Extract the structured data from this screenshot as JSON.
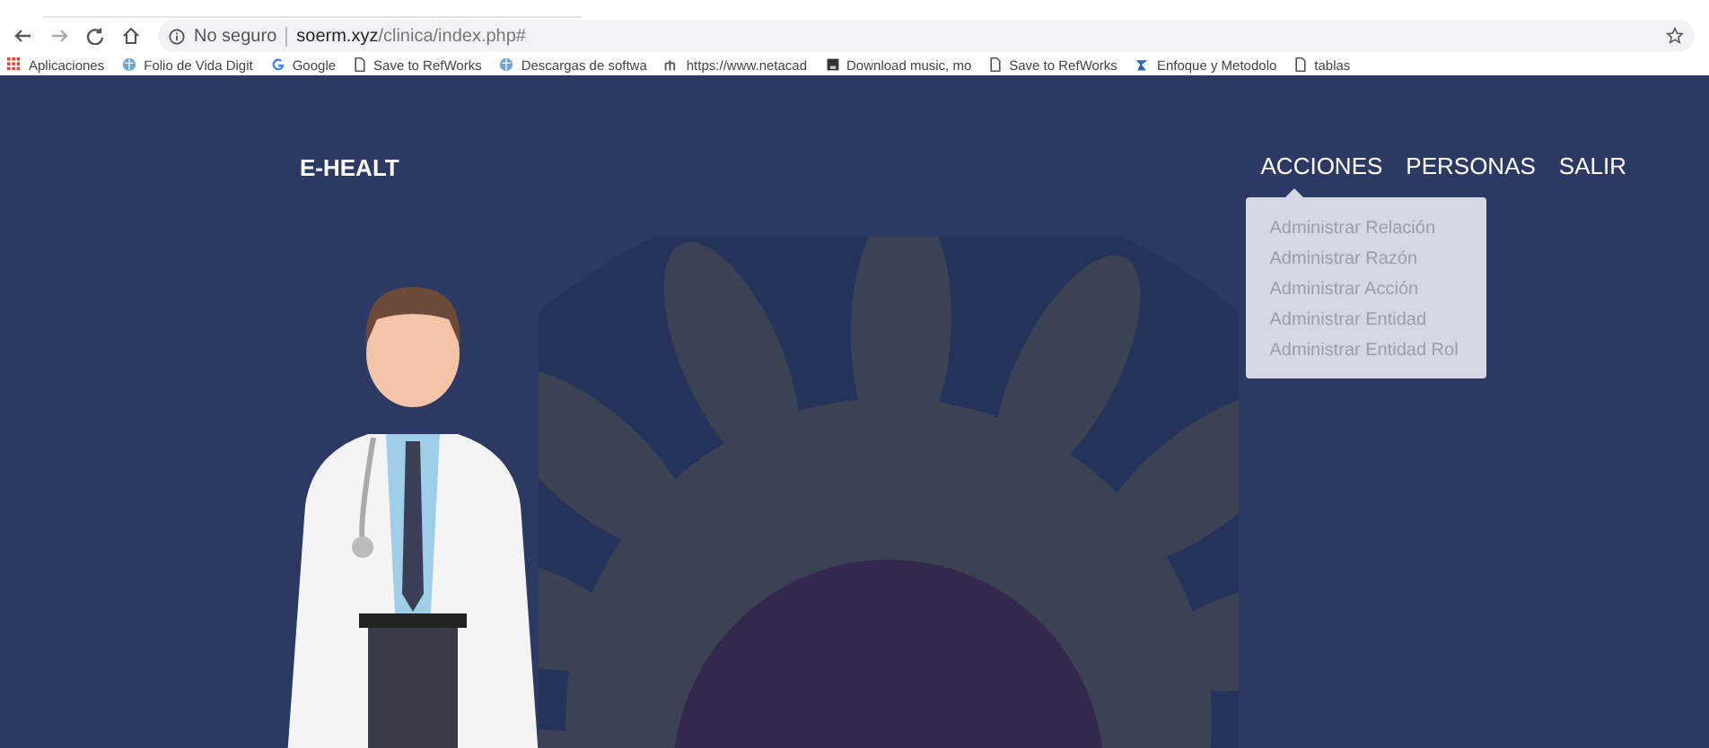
{
  "browser": {
    "security": "No seguro",
    "url": "**soerm.xyz**/clinica/index.php#",
    "bookmarks": [
      {
        "label": "Aplicaciones",
        "kind": "apps"
      },
      {
        "label": "Folio de Vida Digit",
        "kind": "globe"
      },
      {
        "label": "Google",
        "kind": "google"
      },
      {
        "label": "Save to RefWorks",
        "kind": "page"
      },
      {
        "label": "Descargas de softwa",
        "kind": "globe"
      },
      {
        "label": "https://www.netacad",
        "kind": "network"
      },
      {
        "label": "Download music, mo",
        "kind": "disk"
      },
      {
        "label": "Save to RefWorks",
        "kind": "page"
      },
      {
        "label": "Enfoque y Metodolo",
        "kind": "logo"
      },
      {
        "label": "tablas",
        "kind": "page"
      }
    ]
  },
  "site": {
    "brand": "E-HEALT",
    "nav": [
      {
        "label": "ACCIONES",
        "expanded": true
      },
      {
        "label": "PERSONAS",
        "expanded": false
      },
      {
        "label": "SALIR",
        "expanded": false
      }
    ],
    "dropdown": [
      "Administrar Relación",
      "Administrar Razón",
      "Administrar Acción",
      "Administrar Entidad",
      "Administrar Entidad Rol"
    ]
  }
}
